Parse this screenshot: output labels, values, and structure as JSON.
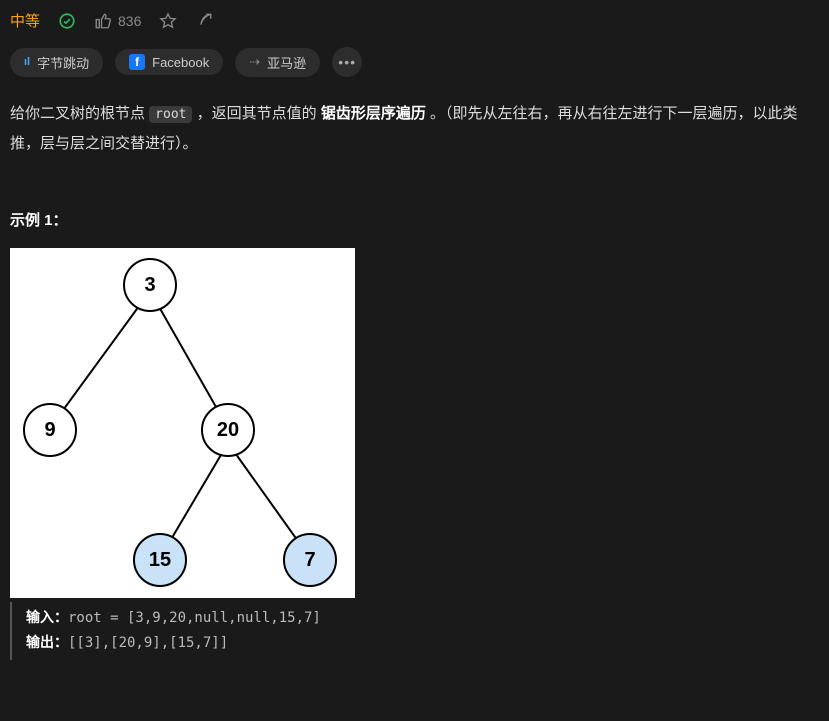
{
  "header": {
    "difficulty": "中等",
    "likes": "836"
  },
  "tags": {
    "bytedance": "字节跳动",
    "facebook": "Facebook",
    "amazon": "亚马逊"
  },
  "desc": {
    "part1": "给你二叉树的根节点 ",
    "code_var": "root",
    "part2": " ，返回其节点值的 ",
    "bold": "锯齿形层序遍历",
    "part3": " 。（即先从左往右，再从右往左进行下一层遍历，以此类推，层与层之间交替进行）。"
  },
  "example": {
    "heading": "示例 1：",
    "tree_nodes": {
      "root": "3",
      "left": "9",
      "right": "20",
      "rl": "15",
      "rr": "7"
    },
    "input_label": "输入：",
    "input_value": "root = [3,9,20,null,null,15,7]",
    "output_label": "输出：",
    "output_value": "[[3],[20,9],[15,7]]"
  }
}
